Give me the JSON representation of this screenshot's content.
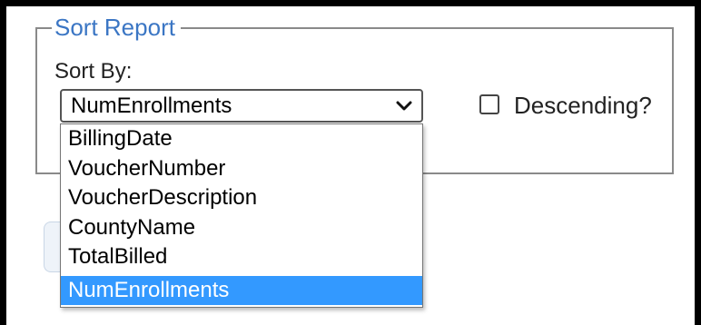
{
  "sort_report": {
    "legend": "Sort Report",
    "sort_by_label": "Sort By:",
    "select": {
      "selected_value": "NumEnrollments",
      "options": [
        "BillingDate",
        "VoucherNumber",
        "VoucherDescription",
        "CountyName",
        "TotalBilled",
        "NumEnrollments"
      ],
      "highlighted_index": 5
    },
    "descending": {
      "label": "Descending?",
      "checked": false
    }
  },
  "icons": {
    "select_arrow": "chevron-down-icon"
  },
  "colors": {
    "legend_text": "#3b76c4",
    "highlight": "#3399ff",
    "outer_frame": "#000000"
  }
}
